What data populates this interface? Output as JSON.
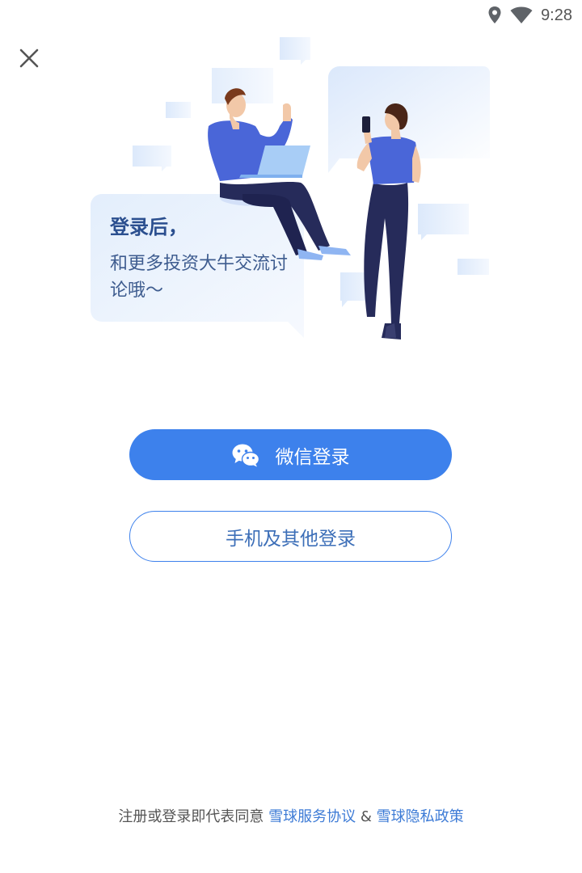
{
  "status_bar": {
    "time": "9:28",
    "icons": [
      "location-icon",
      "wifi-icon"
    ]
  },
  "close": {
    "icon": "close-icon"
  },
  "speech": {
    "title": "登录后，",
    "body": "和更多投资大牛交流讨论哦～"
  },
  "buttons": {
    "wechat_label": "微信登录",
    "wechat_icon": "wechat-icon",
    "other_label": "手机及其他登录"
  },
  "footer": {
    "prefix": "注册或登录即代表同意",
    "terms_link": "雪球服务协议",
    "separator": "&",
    "privacy_link": "雪球隐私政策"
  },
  "colors": {
    "accent": "#3d81ec",
    "link": "#3d7bd6",
    "speech_title": "#2b4f8f"
  }
}
